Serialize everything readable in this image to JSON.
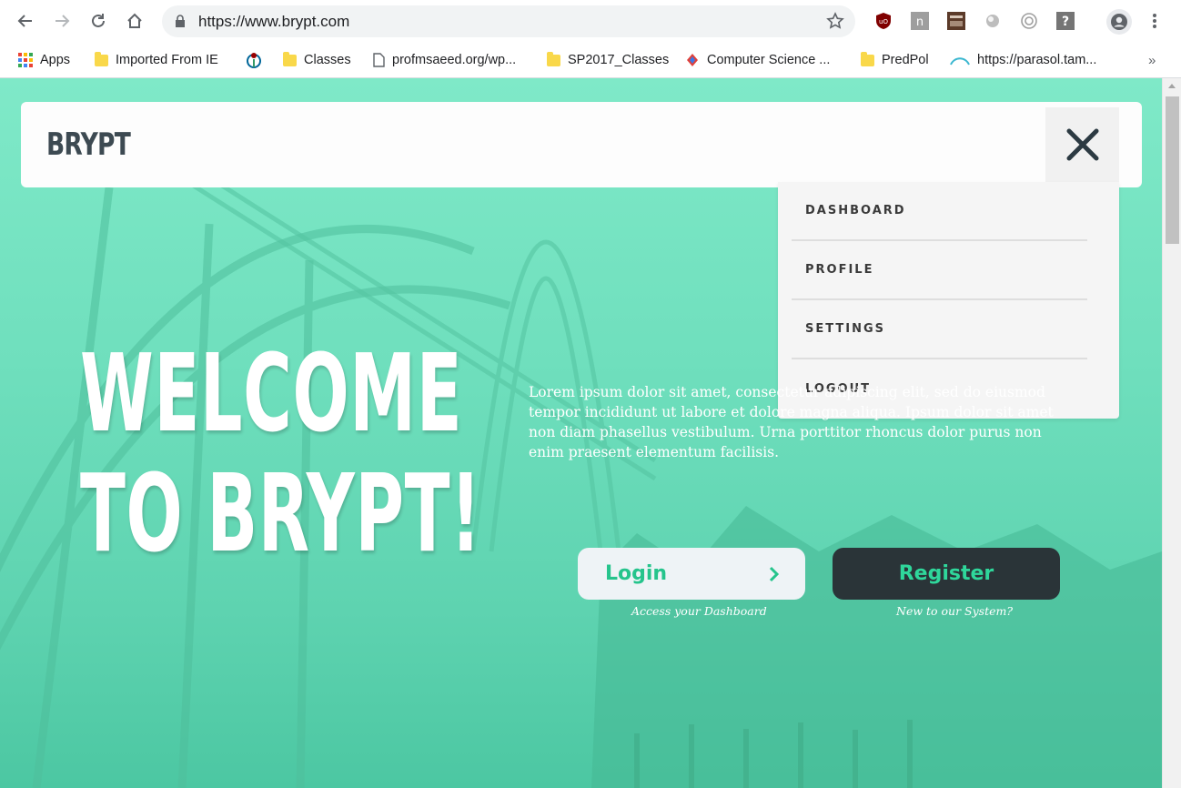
{
  "browser": {
    "url": "https://www.brypt.com",
    "bookmarks": [
      {
        "label": "Apps",
        "icon": "apps-grid-icon"
      },
      {
        "label": "Imported From IE",
        "icon": "folder-icon"
      },
      {
        "label": "",
        "icon": "wikimedia-icon"
      },
      {
        "label": "Classes",
        "icon": "folder-icon"
      },
      {
        "label": "profmsaeed.org/wp...",
        "icon": "page-icon"
      },
      {
        "label": "SP2017_Classes",
        "icon": "folder-icon"
      },
      {
        "label": "Computer Science ...",
        "icon": "site-icon"
      },
      {
        "label": "PredPol",
        "icon": "folder-icon"
      },
      {
        "label": "https://parasol.tam...",
        "icon": "site-icon"
      }
    ],
    "overflow": "»"
  },
  "header": {
    "brand": "BRYPT"
  },
  "menu": {
    "items": [
      "DASHBOARD",
      "PROFILE",
      "SETTINGS",
      "LOGOUT"
    ]
  },
  "hero": {
    "title_line1": "WELCOME",
    "title_line2": "TO BRYPT!",
    "body": "Lorem ipsum dolor sit amet, consectetur adipiscing elit, sed do eiusmod tempor incididunt ut labore et dolore magna aliqua. Ipsum dolor sit amet non diam phasellus vestibulum. Urna porttitor rhoncus dolor purus non enim praesent elementum facilisis."
  },
  "actions": {
    "login_label": "Login",
    "login_caption": "Access your Dashboard",
    "register_label": "Register",
    "register_caption": "New to our System?"
  },
  "colors": {
    "hero_green": "#6fdfbd",
    "accent_green": "#25c48c",
    "dark_button": "#2a3438"
  }
}
